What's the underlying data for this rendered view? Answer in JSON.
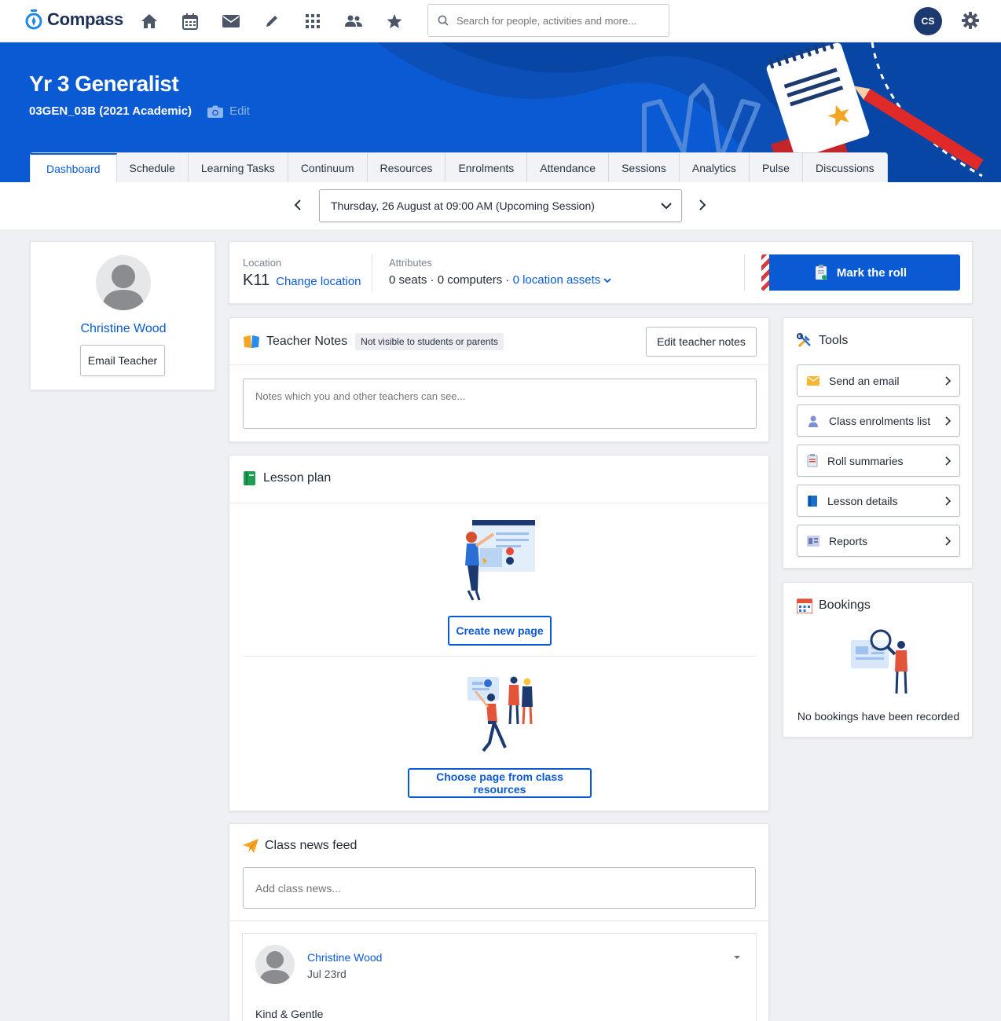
{
  "app": {
    "name": "Compass"
  },
  "nav": {
    "search_placeholder": "Search for people, activities and more...",
    "user_initials": "CS"
  },
  "hero": {
    "title": "Yr 3 Generalist",
    "subtitle": "03GEN_03B (2021 Academic)",
    "edit_label": "Edit"
  },
  "tabs": [
    "Dashboard",
    "Schedule",
    "Learning Tasks",
    "Continuum",
    "Resources",
    "Enrolments",
    "Attendance",
    "Sessions",
    "Analytics",
    "Pulse",
    "Discussions"
  ],
  "session": {
    "selected": "Thursday, 26 August at 09:00 AM (Upcoming Session)"
  },
  "teacher": {
    "name": "Christine Wood",
    "email_button": "Email Teacher"
  },
  "location": {
    "label": "Location",
    "value": "K11",
    "change_label": "Change location",
    "attributes_label": "Attributes",
    "attributes_text": "0 seats · 0 computers ·",
    "assets_link": "0 location assets",
    "mark_roll": "Mark the roll"
  },
  "teacher_notes": {
    "title": "Teacher Notes",
    "badge": "Not visible to students or parents",
    "edit_button": "Edit teacher notes",
    "placeholder": "Notes which you and other teachers can see..."
  },
  "lesson_plan": {
    "title": "Lesson plan",
    "create_button": "Create new page",
    "choose_button": "Choose page from class resources"
  },
  "news": {
    "title": "Class news feed",
    "placeholder": "Add class news...",
    "post": {
      "author": "Christine Wood",
      "date": "Jul 23rd",
      "title": "Kind & Gentle"
    }
  },
  "tools": {
    "title": "Tools",
    "items": [
      "Send an email",
      "Class enrolments list",
      "Roll summaries",
      "Lesson details",
      "Reports"
    ]
  },
  "bookings": {
    "title": "Bookings",
    "empty": "No bookings have been recorded"
  },
  "colors": {
    "primary": "#0a5ad3",
    "navy": "#1c2f55",
    "accent_orange": "#f5a524"
  }
}
